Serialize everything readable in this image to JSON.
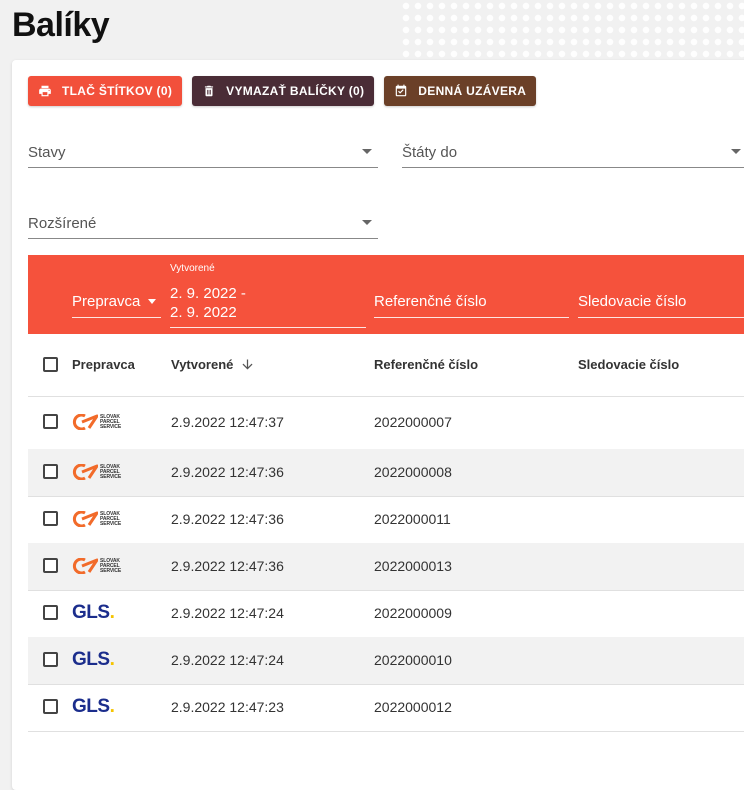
{
  "page": {
    "title": "Balíky"
  },
  "toolbar": {
    "print_label": "TLAČ ŠTÍTKOV (0)",
    "delete_label": "VYMAZAŤ BALÍČKY (0)",
    "closure_label": "DENNÁ UZÁVERA",
    "print_color": "#f2503b",
    "delete_color": "#4a2c36",
    "closure_color": "#6b4028"
  },
  "filters": {
    "states_label": "Stavy",
    "countries_label": "Štáty do",
    "extended_label": "Rozšírené"
  },
  "filter_bar": {
    "carrier_label": "Prepravca",
    "created_small_label": "Vytvorené",
    "created_range_from": "2. 9. 2022 -",
    "created_range_to": "2. 9. 2022",
    "reference_label": "Referenčné číslo",
    "tracking_label": "Sledovacie číslo",
    "color": "#f5523c"
  },
  "table": {
    "columns": [
      "Prepravca",
      "Vytvorené",
      "Referenčné číslo",
      "Sledovacie číslo"
    ],
    "sort_icon": "arrow-down-icon",
    "rows": [
      {
        "carrier": "sps",
        "carrier_text": "SLOVAK PARCEL SERVICE",
        "created": "2.9.2022 12:47:37",
        "reference": "2022000007",
        "tracking": ""
      },
      {
        "carrier": "sps",
        "carrier_text": "SLOVAK PARCEL SERVICE",
        "created": "2.9.2022 12:47:36",
        "reference": "2022000008",
        "tracking": ""
      },
      {
        "carrier": "sps",
        "carrier_text": "SLOVAK PARCEL SERVICE",
        "created": "2.9.2022 12:47:36",
        "reference": "2022000011",
        "tracking": ""
      },
      {
        "carrier": "sps",
        "carrier_text": "SLOVAK PARCEL SERVICE",
        "created": "2.9.2022 12:47:36",
        "reference": "2022000013",
        "tracking": ""
      },
      {
        "carrier": "gls",
        "carrier_text": "GLS",
        "created": "2.9.2022 12:47:24",
        "reference": "2022000009",
        "tracking": ""
      },
      {
        "carrier": "gls",
        "carrier_text": "GLS",
        "created": "2.9.2022 12:47:24",
        "reference": "2022000010",
        "tracking": ""
      },
      {
        "carrier": "gls",
        "carrier_text": "GLS",
        "created": "2.9.2022 12:47:23",
        "reference": "2022000012",
        "tracking": ""
      }
    ]
  }
}
